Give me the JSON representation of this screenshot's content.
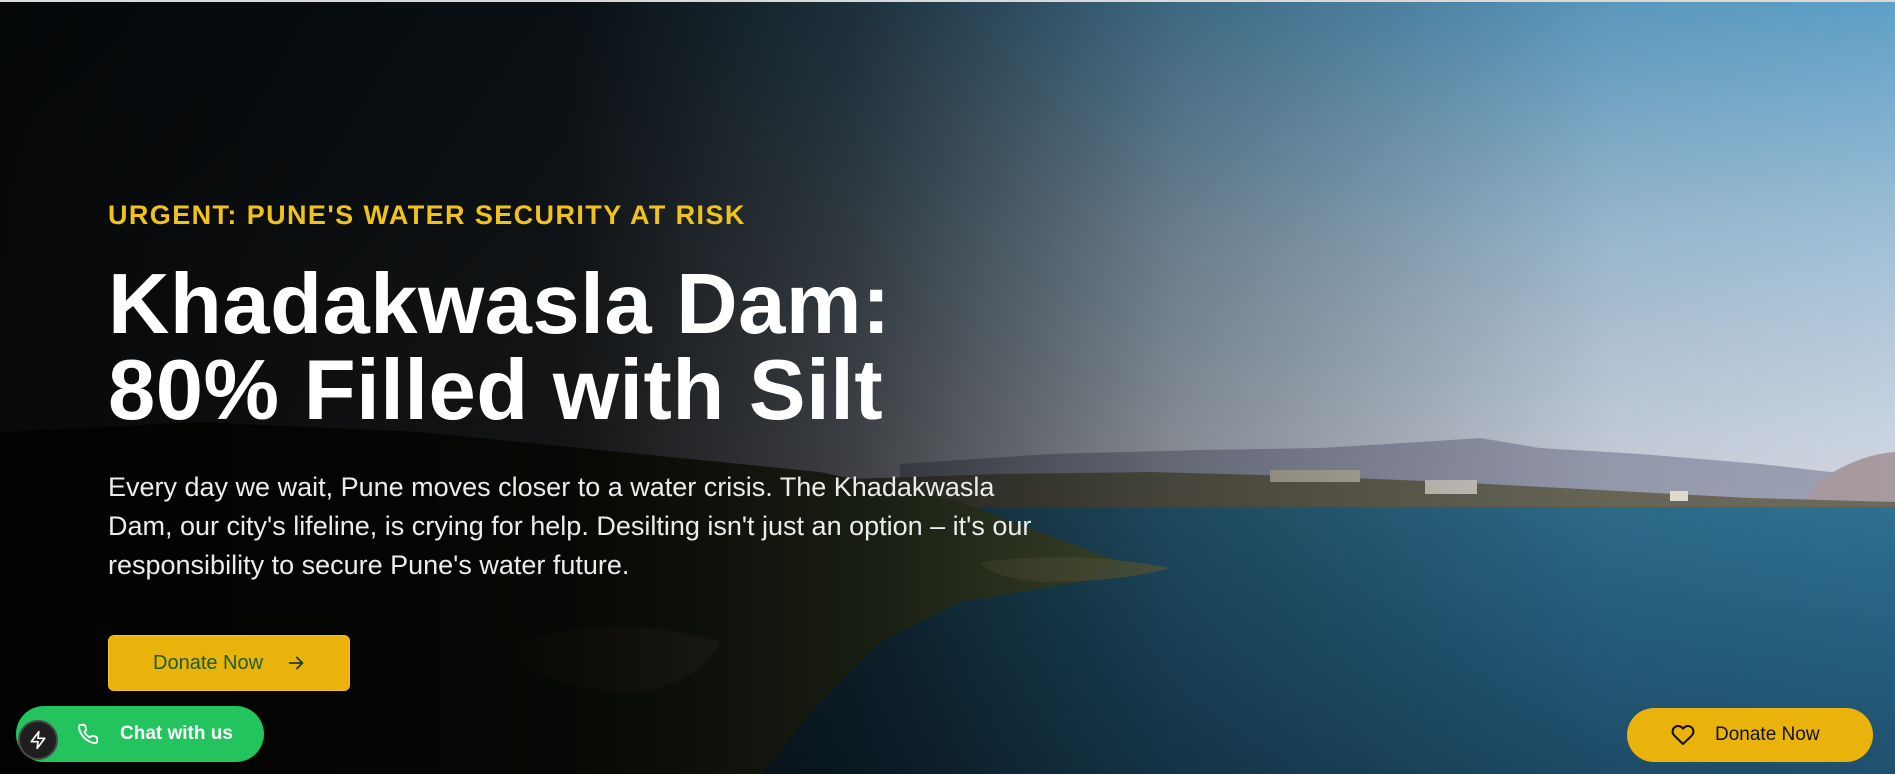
{
  "hero": {
    "eyebrow": "URGENT: PUNE'S WATER SECURITY AT RISK",
    "headline_line1": "Khadakwasla Dam:",
    "headline_line2": "80% Filled with Silt",
    "subtext": "Every day we wait, Pune moves closer to a water crisis. The Khadakwasla Dam, our city's lifeline, is crying for help. Desilting isn't just an option – it's our responsibility to secure Pune's water future.",
    "cta_label": "Donate Now",
    "cta_icon": "arrow-right-icon"
  },
  "chat_widget": {
    "label": "Chat with us",
    "icons": [
      "bolt-icon",
      "phone-icon"
    ]
  },
  "floating_donate": {
    "label": "Donate Now",
    "icon": "heart-icon"
  },
  "colors": {
    "accent_yellow": "#e9b30b",
    "eyebrow_yellow": "#f1c31a",
    "cta_text_green": "#1f5b2a",
    "chat_green": "#23c45e",
    "text_white": "#ffffff"
  }
}
